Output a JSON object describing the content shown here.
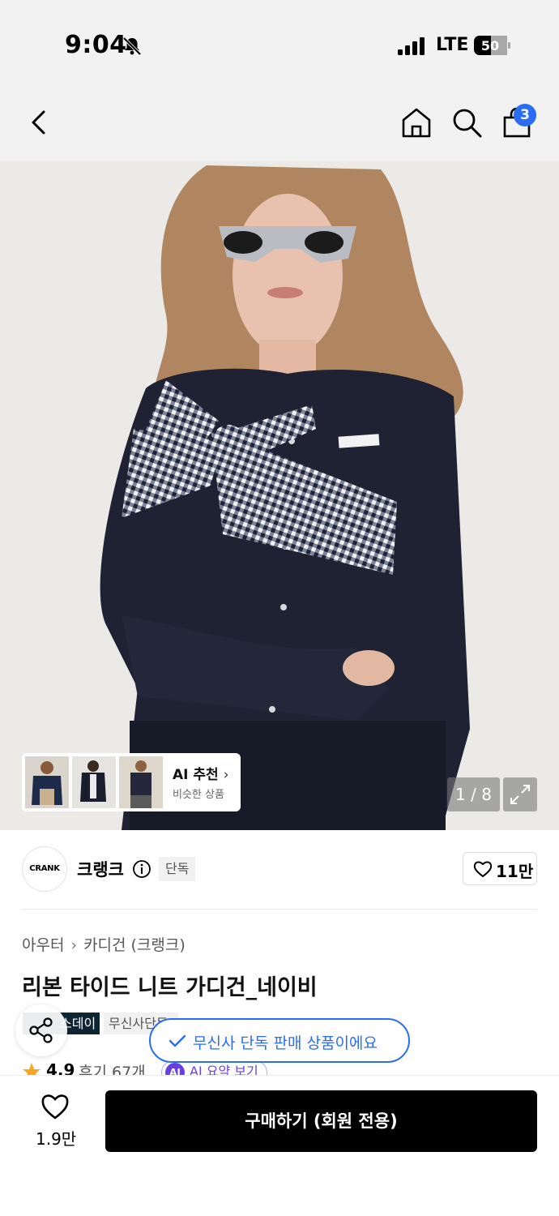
{
  "status_bar": {
    "time": "9:04",
    "network": "LTE",
    "battery": "50",
    "icons": [
      "bell-muted-icon",
      "signal-icon",
      "battery-icon"
    ]
  },
  "nav": {
    "icons": [
      "back-icon",
      "home-icon",
      "search-icon",
      "cart-icon"
    ],
    "cart_badge": "3"
  },
  "gallery": {
    "counter": "1 / 8",
    "ai_recommend": {
      "title": "AI 추천",
      "subtitle": "비슷한 상품"
    }
  },
  "brand": {
    "logo_text": "CRANK",
    "name": "크랭크",
    "exclusive_tag": "단독",
    "likes": "11만"
  },
  "product": {
    "breadcrumb": [
      "아우터",
      "카디건 (크랭크)"
    ],
    "title": "리본 타이드 니트 가디건_네이비",
    "tags": [
      "스데이",
      "무신사단독"
    ],
    "rating": "4.9",
    "reviews": "후기 67개",
    "ai_summary_badge": "AI",
    "ai_summary": "AI 요약 보기"
  },
  "toast": {
    "text": "무신사 단독 판매 상품이에요"
  },
  "bottom": {
    "like_count": "1.9만",
    "buy_label": "구매하기 (회원 전용)"
  },
  "colors": {
    "accent": "#2a6df4",
    "ai_purple": "#6a3fe0",
    "star": "#f5a623"
  }
}
